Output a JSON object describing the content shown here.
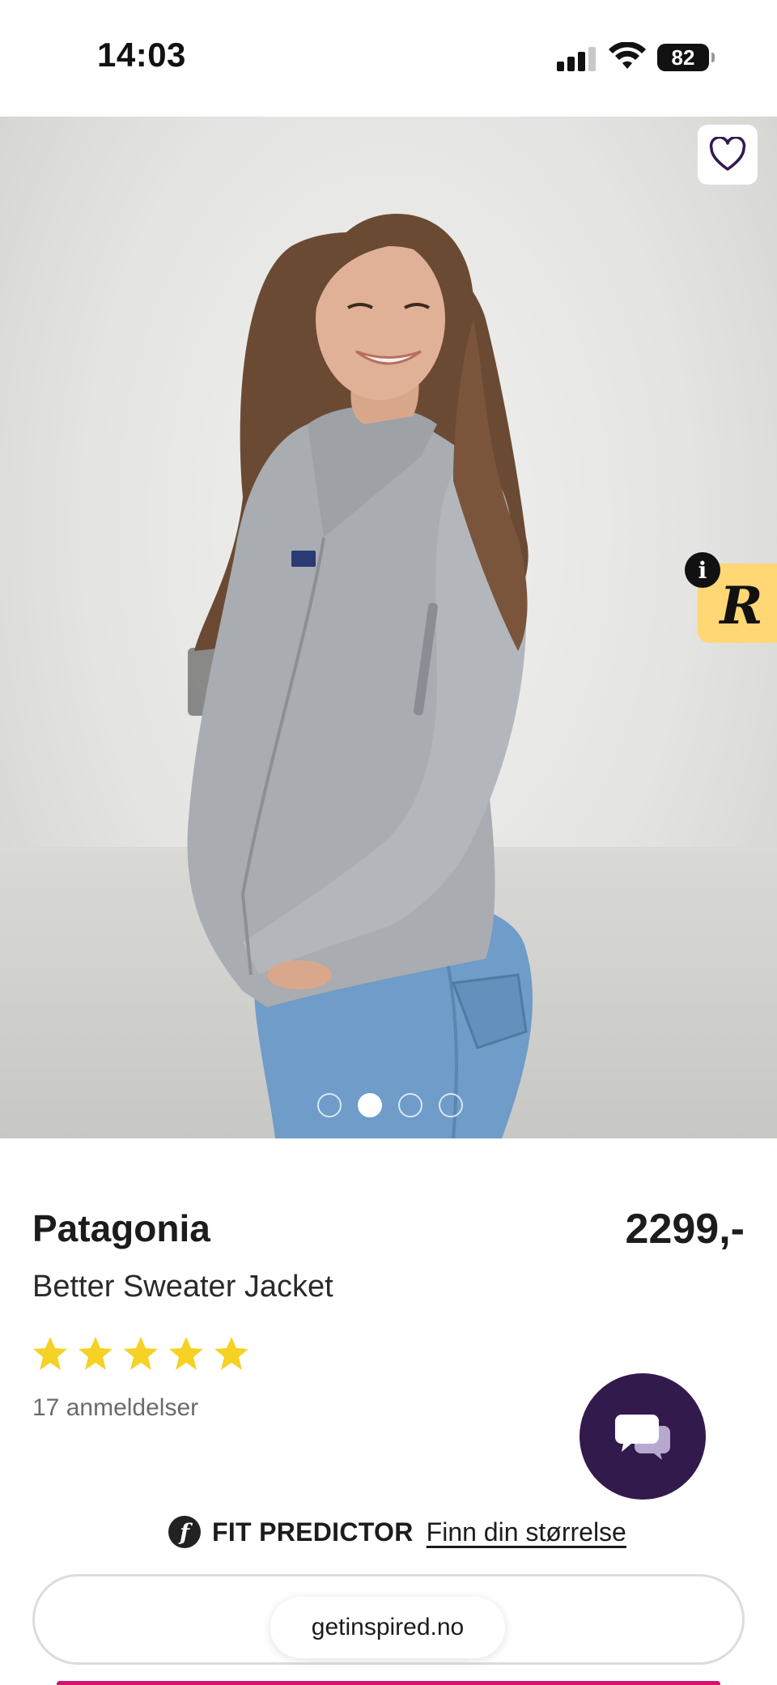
{
  "status_bar": {
    "time": "14:03",
    "battery": "82",
    "icons": [
      "cellular-signal-icon",
      "wifi-icon",
      "battery-icon"
    ]
  },
  "gallery": {
    "image_count": 4,
    "active_index": 1,
    "favorite_icon": "heart-outline-icon",
    "badge_letter": "R",
    "info_label": "i"
  },
  "product": {
    "brand": "Patagonia",
    "name": "Better Sweater Jacket",
    "price": "2299,-",
    "rating": 5,
    "reviews_label": "17 anmeldelser"
  },
  "fit_predictor": {
    "label": "FIT PREDICTOR",
    "link": "Finn din størrelse",
    "icon_letter": "f"
  },
  "browser": {
    "url": "getinspired.no"
  },
  "colors": {
    "accent_purple": "#331a4d",
    "star_yellow": "#f5d223",
    "badge_yellow": "#ffd774",
    "cta_pink": "#d3136e"
  }
}
